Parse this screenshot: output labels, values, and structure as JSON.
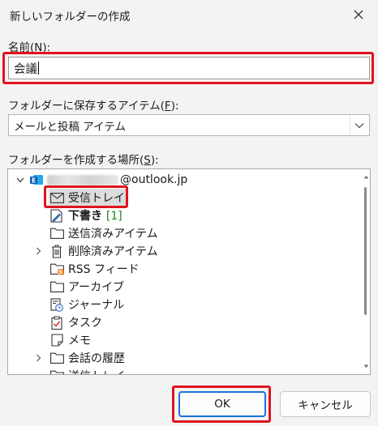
{
  "window": {
    "title": "新しいフォルダーの作成"
  },
  "name_field": {
    "label": "名前(",
    "mnemonic": "N",
    "label_end": "):",
    "value": "会議"
  },
  "folder_type": {
    "label": "フォルダーに保存するアイテム(",
    "mnemonic": "F",
    "label_end": "):",
    "value": "メールと投稿 アイテム"
  },
  "location": {
    "label": "フォルダーを作成する場所(",
    "mnemonic": "S",
    "label_end": "):"
  },
  "tree": {
    "account": "@outlook.jp",
    "items": [
      {
        "label": "受信トレイ",
        "icon": "envelope-icon"
      },
      {
        "label": "下書き",
        "count": "[1]",
        "icon": "pencil-note-icon"
      },
      {
        "label": "送信済みアイテム",
        "icon": "folder-icon"
      },
      {
        "label": "削除済みアイテム",
        "icon": "trash-icon"
      },
      {
        "label": "RSS フィード",
        "icon": "rss-icon"
      },
      {
        "label": "アーカイブ",
        "icon": "folder-icon"
      },
      {
        "label": "ジャーナル",
        "icon": "journal-icon"
      },
      {
        "label": "タスク",
        "icon": "task-icon"
      },
      {
        "label": "メモ",
        "icon": "note-icon"
      },
      {
        "label": "会話の履歴",
        "icon": "folder-icon"
      },
      {
        "label": "送信トレイ",
        "icon": "outbox-icon"
      }
    ]
  },
  "buttons": {
    "ok": "OK",
    "cancel": "キャンセル"
  },
  "colors": {
    "highlight": "#e0131e",
    "accent": "#1a73d9",
    "count": "#1c8a1c"
  }
}
